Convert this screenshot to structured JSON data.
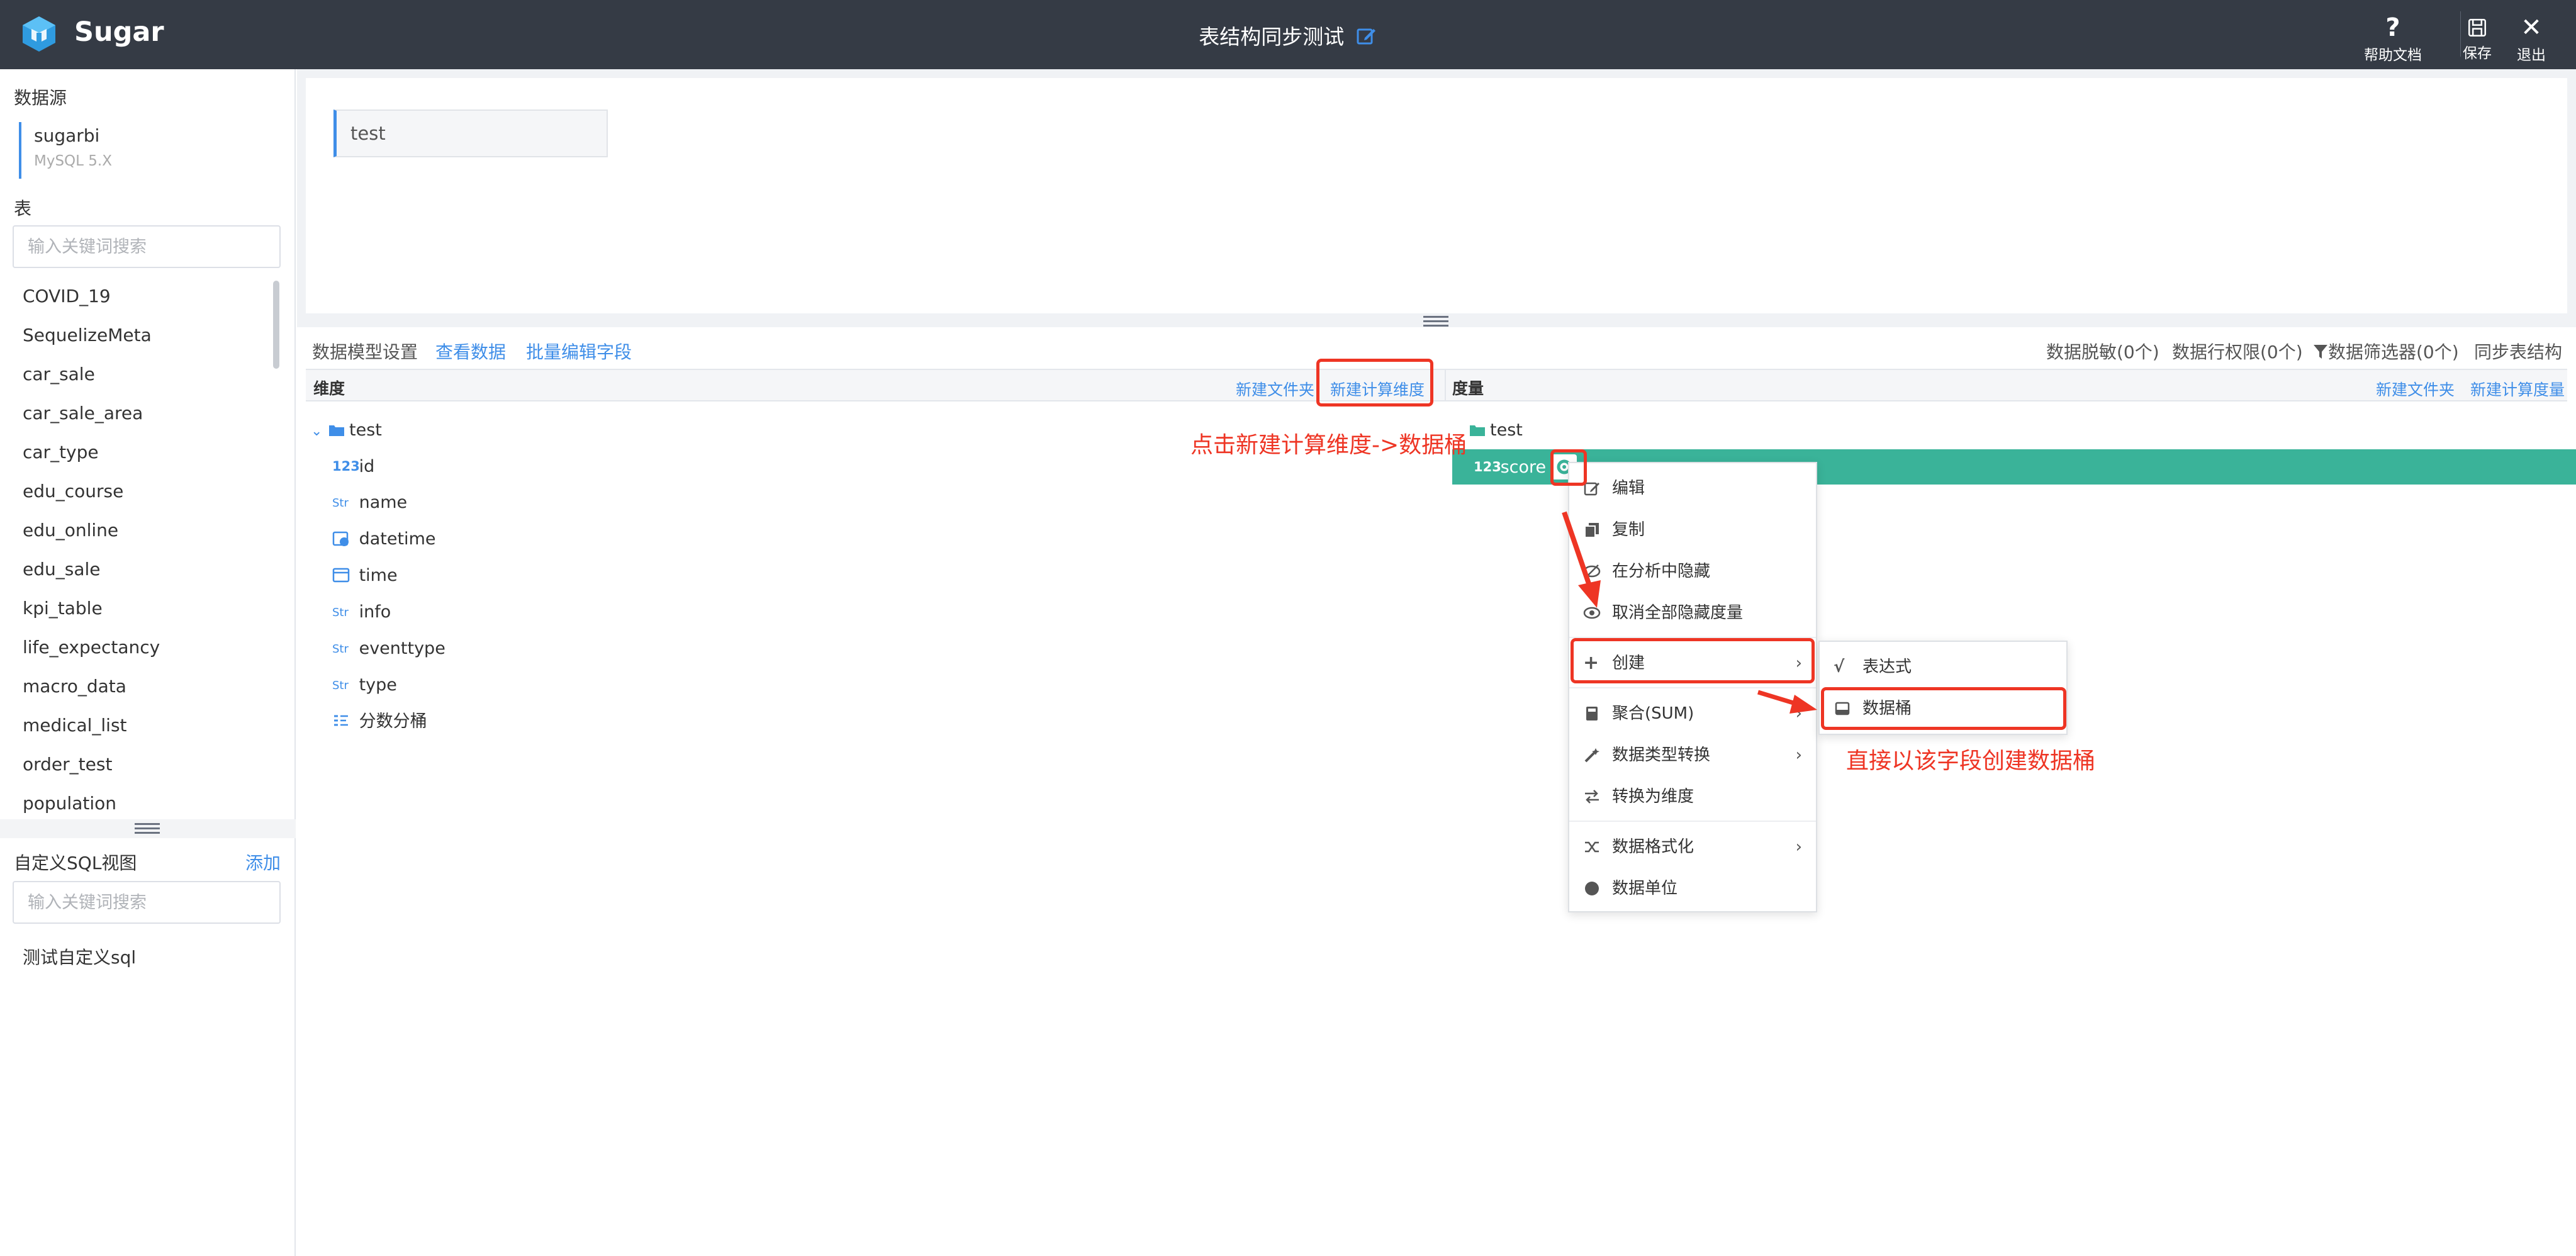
{
  "app": {
    "brand": "Sugar",
    "page_title": "表结构同步测试",
    "actions": {
      "help": "帮助文档",
      "save": "保存",
      "exit": "退出"
    }
  },
  "sidebar": {
    "datasource_title": "数据源",
    "datasource_name": "sugarbi",
    "datasource_type": "MySQL 5.X",
    "table_title": "表",
    "table_search_placeholder": "输入关键词搜索",
    "tables": [
      "COVID_19",
      "SequelizeMeta",
      "car_sale",
      "car_sale_area",
      "car_type",
      "edu_course",
      "edu_online",
      "edu_sale",
      "kpi_table",
      "life_expectancy",
      "macro_data",
      "medical_list",
      "order_test",
      "population"
    ],
    "custom_sql_title": "自定义SQL视图",
    "custom_sql_add": "添加",
    "custom_sql_search_placeholder": "输入关键词搜索",
    "custom_sql_items": [
      "测试自定义sql"
    ]
  },
  "canvas": {
    "table_node": "test"
  },
  "tabs": {
    "model_settings": "数据模型设置",
    "view_data": "查看数据",
    "batch_edit": "批量编辑字段",
    "desensitize": "数据脱敏(0个)",
    "row_permission": "数据行权限(0个)",
    "filter": "数据筛选器(0个)",
    "sync": "同步表结构"
  },
  "dimensions": {
    "title": "维度",
    "new_folder": "新建文件夹",
    "new_calc": "新建计算维度",
    "folder": "test",
    "fields": [
      {
        "type": "123",
        "name": "id"
      },
      {
        "type": "Str",
        "name": "name"
      },
      {
        "type": "datetime-icon",
        "name": "datetime"
      },
      {
        "type": "calendar-icon",
        "name": "time"
      },
      {
        "type": "Str",
        "name": "info"
      },
      {
        "type": "Str",
        "name": "eventtype"
      },
      {
        "type": "Str",
        "name": "type"
      },
      {
        "type": "bucket-icon",
        "name": "分数分桶"
      }
    ]
  },
  "measures": {
    "title": "度量",
    "new_folder": "新建文件夹",
    "new_calc": "新建计算度量",
    "folder": "test",
    "field": {
      "type": "123",
      "name": "score"
    }
  },
  "context_menu": {
    "items": [
      "编辑",
      "复制",
      "在分析中隐藏",
      "取消全部隐藏度量",
      "创建",
      "聚合(SUM)",
      "数据类型转换",
      "转换为维度",
      "数据格式化",
      "数据单位"
    ],
    "submenu": [
      "表达式",
      "数据桶"
    ]
  },
  "annotations": {
    "note1": "点击新建计算维度->数据桶",
    "note2": "直接以该字段创建数据桶"
  },
  "colors": {
    "topbar": "#353b45",
    "accent": "#3f8ee8",
    "measure_highlight": "#3ab399",
    "annotation": "#ee3524"
  }
}
